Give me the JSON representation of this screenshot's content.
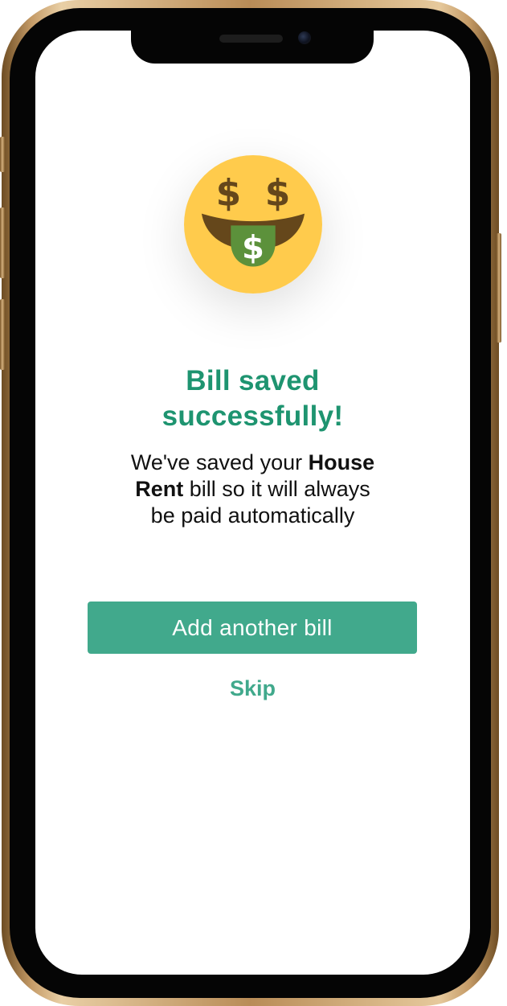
{
  "confirmation": {
    "icon": "money-mouth-face-icon",
    "title_line1": "Bill saved",
    "title_line2": "successfully!",
    "message": {
      "line1_prefix": "We've saved your ",
      "line1_bold": "House",
      "line2_bold": "Rent",
      "line2_suffix": " bill so it will always",
      "line3": "be paid automatically"
    }
  },
  "actions": {
    "add_another_label": "Add another bill",
    "skip_label": "Skip"
  },
  "colors": {
    "accent": "#41a98c",
    "title_green": "#1e9470",
    "emoji_yellow": "#ffcb4c",
    "emoji_brown": "#65471b",
    "tongue_green": "#5c913b"
  }
}
